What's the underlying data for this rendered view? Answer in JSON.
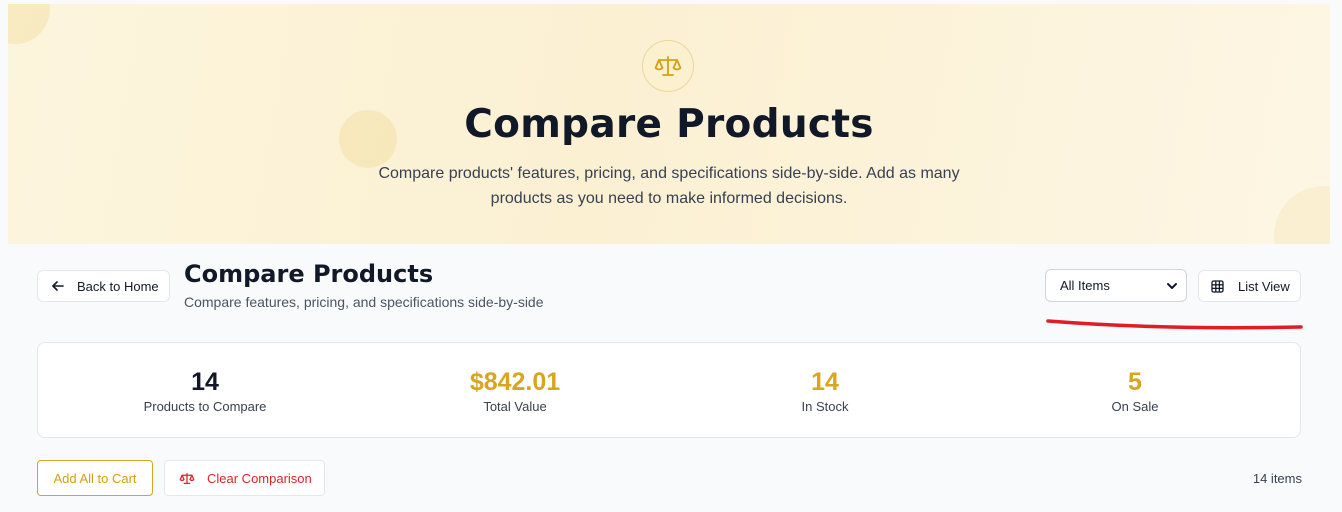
{
  "hero": {
    "icon": "scale-icon",
    "title": "Compare Products",
    "subtitle": "Compare products' features, pricing, and specifications side-by-side. Add as many products as you need to make informed decisions."
  },
  "header": {
    "back_label": "Back to Home",
    "title": "Compare Products",
    "subtitle": "Compare features, pricing, and specifications side-by-side",
    "filter_selected": "All Items",
    "view_label": "List View"
  },
  "stats": [
    {
      "value": "14",
      "label": "Products to Compare",
      "color": "#111827"
    },
    {
      "value": "$842.01",
      "label": "Total Value",
      "color": "#d9a521"
    },
    {
      "value": "14",
      "label": "In Stock",
      "color": "#d9a521"
    },
    {
      "value": "5",
      "label": "On Sale",
      "color": "#d9a521"
    }
  ],
  "actions": {
    "add_all_label": "Add All to Cart",
    "clear_label": "Clear Comparison",
    "item_count": "14 items"
  },
  "colors": {
    "accent": "#d9a521",
    "danger": "#dc2626",
    "annotation": "#e11d24"
  }
}
